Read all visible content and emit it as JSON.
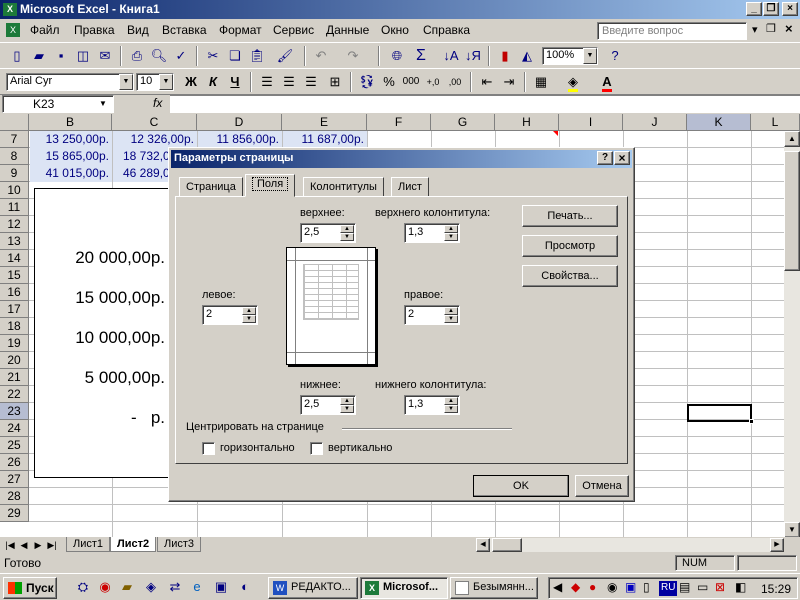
{
  "window": {
    "title": "Microsoft Excel - Книга1"
  },
  "menu": {
    "items": [
      "Файл",
      "Правка",
      "Вид",
      "Вставка",
      "Формат",
      "Сервис",
      "Данные",
      "Окно",
      "Справка"
    ],
    "help_placeholder": "Введите вопрос"
  },
  "toolbar": {
    "zoom": "100%"
  },
  "format_toolbar": {
    "font_name": "Arial Cyr",
    "font_size": "10",
    "bold": "Ж",
    "italic": "К",
    "underline": "Ч"
  },
  "formula_bar": {
    "name_box": "K23",
    "fx": "fx"
  },
  "grid": {
    "columns": [
      "B",
      "C",
      "D",
      "E",
      "F",
      "G",
      "H",
      "I",
      "J",
      "K",
      "L"
    ],
    "rows": [
      "7",
      "8",
      "9",
      "10",
      "11",
      "12",
      "13",
      "14",
      "15",
      "16",
      "17",
      "18",
      "19",
      "20",
      "21",
      "22",
      "23",
      "24",
      "25",
      "26",
      "27",
      "28",
      "29"
    ],
    "data_rows": [
      [
        "13 250,00р.",
        "12 326,00р.",
        "11 856,00р.",
        "11 687,00р."
      ],
      [
        "15 865,00р.",
        "18 732,0",
        "",
        ""
      ],
      [
        "41 015,00р.",
        "46 289,0",
        "",
        ""
      ]
    ],
    "selected_cell": "K23"
  },
  "chart_data": {
    "type": "bar",
    "y_tick_labels": [
      "20 000,00р.",
      "15 000,00р.",
      "10 000,00р.",
      "5 000,00р.",
      "-   р."
    ]
  },
  "sheets": {
    "tabs": [
      "Лист1",
      "Лист2",
      "Лист3"
    ],
    "active": "Лист2"
  },
  "status": {
    "text": "Готово",
    "num": "NUM"
  },
  "taskbar": {
    "start": "Пуск",
    "tasks": [
      "РЕДАКТО...",
      "Microsof...",
      "Безымянн..."
    ],
    "lang": "RU",
    "clock": "15:29"
  },
  "dialog": {
    "title": "Параметры страницы",
    "tabs": [
      "Страница",
      "Поля",
      "Колонтитулы",
      "Лист"
    ],
    "active_tab": "Поля",
    "labels": {
      "top": "верхнее:",
      "header": "верхнего колонтитула:",
      "left": "левое:",
      "right": "правое:",
      "bottom": "нижнее:",
      "footer": "нижнего колонтитула:",
      "center": "Центрировать на странице",
      "horizontal": "горизонтально",
      "vertical": "вертикально"
    },
    "values": {
      "top": "2,5",
      "header": "1,3",
      "left": "2",
      "right": "2",
      "bottom": "2,5",
      "footer": "1,3"
    },
    "buttons": {
      "print": "Печать...",
      "preview": "Просмотр",
      "properties": "Свойства...",
      "ok": "OK",
      "cancel": "Отмена"
    }
  }
}
